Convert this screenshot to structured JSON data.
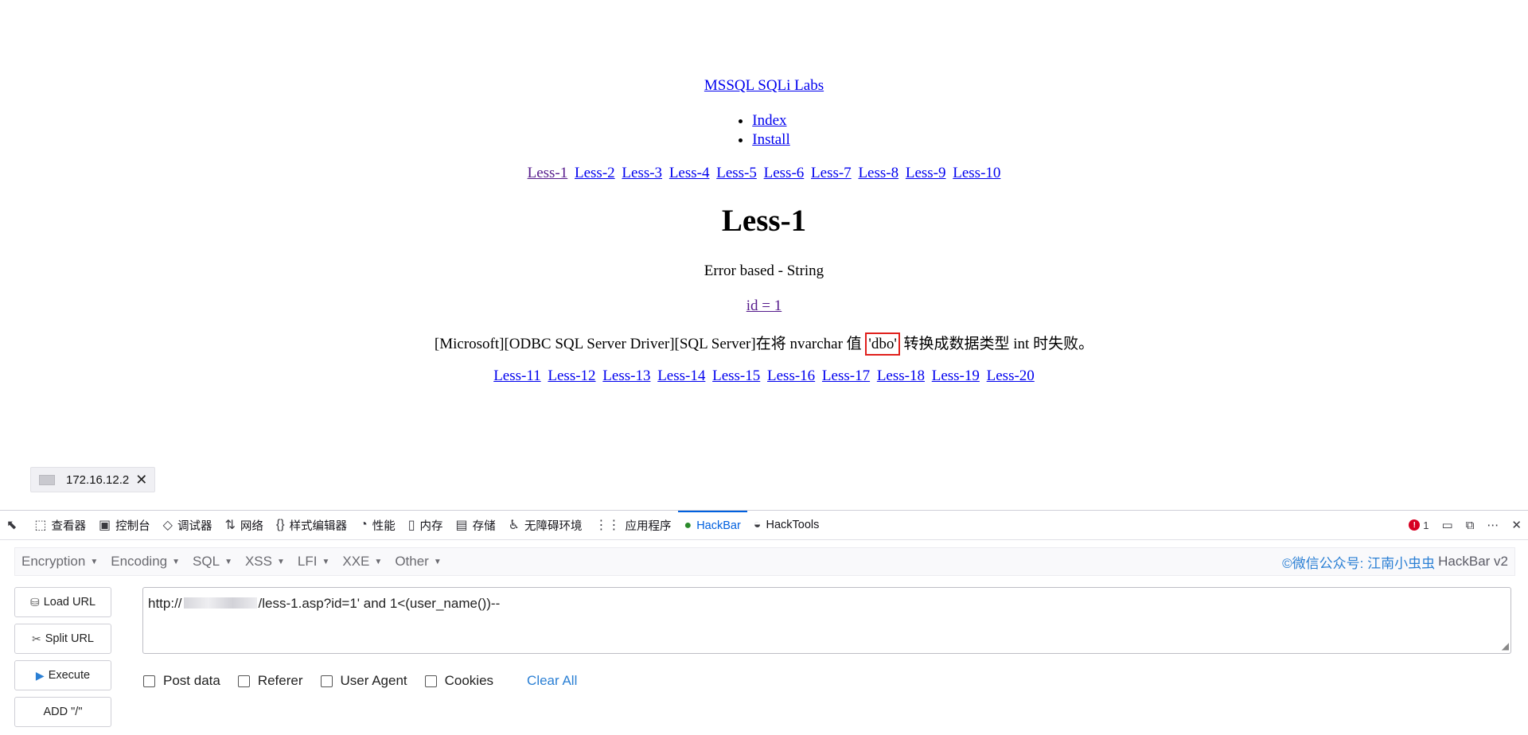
{
  "page": {
    "site_title": "MSSQL SQLi Labs",
    "nav": [
      "Index",
      "Install"
    ],
    "lessons_top": [
      "Less-1",
      "Less-2",
      "Less-3",
      "Less-4",
      "Less-5",
      "Less-6",
      "Less-7",
      "Less-8",
      "Less-9",
      "Less-10"
    ],
    "heading": "Less-1",
    "subtitle": "Error based - String",
    "id_link": "id = 1",
    "error_before": "[Microsoft][ODBC SQL Server Driver][SQL Server]在将 nvarchar 值 ",
    "error_highlight": "'dbo'",
    "error_after": " 转换成数据类型 int 时失败。",
    "lessons_bottom": [
      "Less-11",
      "Less-12",
      "Less-13",
      "Less-14",
      "Less-15",
      "Less-16",
      "Less-17",
      "Less-18",
      "Less-19",
      "Less-20"
    ]
  },
  "status_bar": {
    "host": "172.16.12.2",
    "close": "✕"
  },
  "devtools": {
    "tabs": [
      {
        "icon": "⬚",
        "label": "查看器",
        "name": "inspector"
      },
      {
        "icon": "▣",
        "label": "控制台",
        "name": "console"
      },
      {
        "icon": "◇",
        "label": "调试器",
        "name": "debugger"
      },
      {
        "icon": "⇅",
        "label": "网络",
        "name": "network"
      },
      {
        "icon": "{}",
        "label": "样式编辑器",
        "name": "style-editor"
      },
      {
        "icon": "◔",
        "label": "性能",
        "name": "performance"
      },
      {
        "icon": "▯",
        "label": "内存",
        "name": "memory"
      },
      {
        "icon": "▤",
        "label": "存储",
        "name": "storage"
      },
      {
        "icon": "♿",
        "label": "无障碍环境",
        "name": "accessibility"
      },
      {
        "icon": "⋮⋮",
        "label": "应用程序",
        "name": "application"
      },
      {
        "icon": "●",
        "label": "HackBar",
        "name": "hackbar"
      },
      {
        "icon": "◒",
        "label": "HackTools",
        "name": "hacktools"
      }
    ],
    "error_count": "1"
  },
  "hackbar": {
    "menu": [
      "Encryption",
      "Encoding",
      "SQL",
      "XSS",
      "LFI",
      "XXE",
      "Other"
    ],
    "brand_blue": "©微信公众号: 江南小虫虫",
    "brand_gray": "HackBar v2",
    "buttons": {
      "load_url": "Load URL",
      "split_url": "Split URL",
      "execute": "Execute",
      "add_slash": "ADD \"/\""
    },
    "url_prefix": "http://",
    "url_suffix": "/less-1.asp?id=1' and 1<(user_name())--",
    "checks": [
      "Post data",
      "Referer",
      "User Agent",
      "Cookies"
    ],
    "clear_all": "Clear All"
  }
}
